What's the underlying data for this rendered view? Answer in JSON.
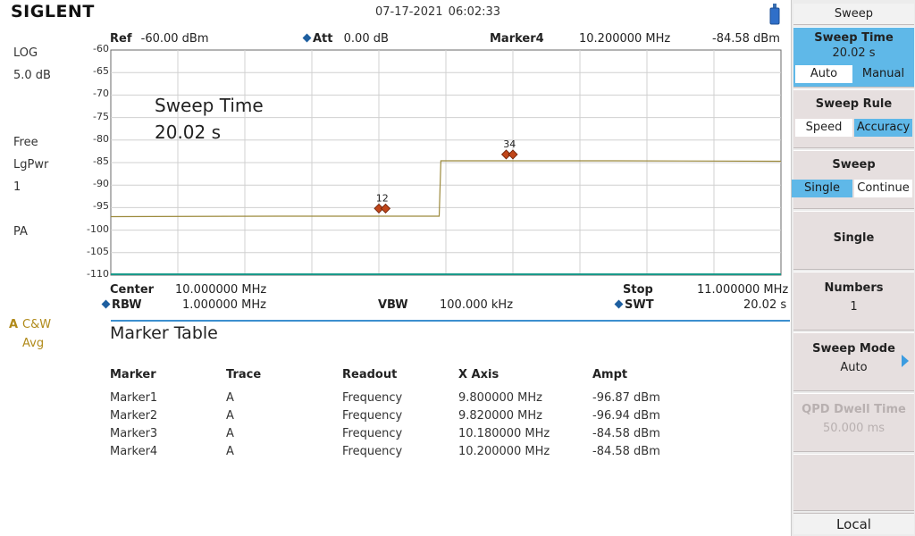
{
  "brand": "SIGLENT",
  "datetime": "07-17-2021   06:02:33",
  "left_info": {
    "scale_type": "LOG",
    "scale_div": "5.0 dB",
    "trigger": "Free",
    "detector": "LgPwr",
    "avg_num": "1",
    "preamp": "PA",
    "trace_label": "A",
    "trace_mode": "C&W",
    "trace_type": "Avg"
  },
  "header": {
    "ref_label": "Ref",
    "ref_value": "-60.00 dBm",
    "att_label": "Att",
    "att_value": "0.00 dB",
    "marker_label": "Marker4",
    "marker_freq": "10.200000 MHz",
    "marker_ampt": "-84.58 dBm"
  },
  "annotation": {
    "line1": "Sweep Time",
    "line2": "20.02 s"
  },
  "footer": {
    "center_label": "Center",
    "center_value": "10.000000 MHz",
    "stop_label": "Stop",
    "stop_value": "11.000000 MHz",
    "rbw_label": "RBW",
    "rbw_value": "1.000000 MHz",
    "vbw_label": "VBW",
    "vbw_value": "100.000 kHz",
    "swt_label": "SWT",
    "swt_value": "20.02 s"
  },
  "chart_data": {
    "type": "line",
    "x_unit": "MHz",
    "xlim": [
      9.0,
      11.0
    ],
    "ylim": [
      -110,
      -60
    ],
    "y_ticks": [
      "-60",
      "-65",
      "-70",
      "-75",
      "-80",
      "-85",
      "-90",
      "-95",
      "-100",
      "-105",
      "-110"
    ],
    "grid": true,
    "series": [
      {
        "color": "#9c8a3c",
        "x": [
          9.0,
          9.5,
          9.8,
          9.98,
          9.985,
          10.0,
          10.2,
          10.5,
          11.0
        ],
        "y": [
          -97.0,
          -96.9,
          -96.9,
          -96.9,
          -84.6,
          -84.6,
          -84.6,
          -84.6,
          -84.7
        ]
      }
    ],
    "markers": [
      {
        "label": "1",
        "x": 9.8,
        "y": -95.2
      },
      {
        "label": "2",
        "x": 9.82,
        "y": -95.2
      },
      {
        "label": "3",
        "x": 10.18,
        "y": -83.2
      },
      {
        "label": "4",
        "x": 10.2,
        "y": -83.2
      }
    ],
    "marker_group_labels": [
      "12",
      "34"
    ]
  },
  "marker_table": {
    "title": "Marker Table",
    "headers": [
      "Marker",
      "Trace",
      "Readout",
      "X Axis",
      "Ampt"
    ],
    "rows": [
      [
        "Marker1",
        "A",
        "Frequency",
        "9.800000 MHz",
        "-96.87 dBm"
      ],
      [
        "Marker2",
        "A",
        "Frequency",
        "9.820000 MHz",
        "-96.94 dBm"
      ],
      [
        "Marker3",
        "A",
        "Frequency",
        "10.180000 MHz",
        "-84.58 dBm"
      ],
      [
        "Marker4",
        "A",
        "Frequency",
        "10.200000 MHz",
        "-84.58 dBm"
      ]
    ]
  },
  "softkeys": {
    "menu_title": "Sweep",
    "sweep_time": {
      "title": "Sweep Time",
      "value": "20.02 s",
      "opt_a": "Auto",
      "opt_b": "Manual"
    },
    "sweep_rule": {
      "title": "Sweep Rule",
      "opt_a": "Speed",
      "opt_b": "Accuracy"
    },
    "sweep": {
      "title": "Sweep",
      "opt_a": "Single",
      "opt_b": "Continue"
    },
    "single": {
      "title": "Single"
    },
    "numbers": {
      "title": "Numbers",
      "value": "1"
    },
    "sweep_mode": {
      "title": "Sweep Mode",
      "value": "Auto"
    },
    "qpd_dwell": {
      "title": "QPD Dwell Time",
      "value": "50.000 ms"
    },
    "local": "Local"
  },
  "colors": {
    "trace": "#9c8a3c",
    "marker": "#c0461a",
    "accent_blue": "#5fb8e8"
  }
}
